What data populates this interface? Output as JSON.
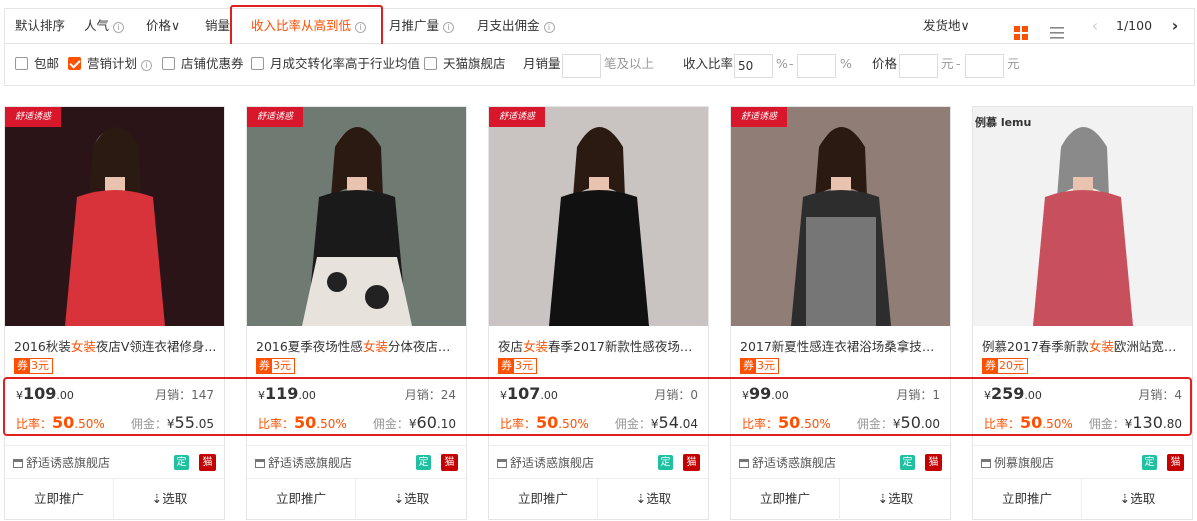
{
  "sortbar": {
    "items": [
      {
        "label": "默认排序"
      },
      {
        "label": "人气"
      },
      {
        "label": "价格"
      },
      {
        "label": "销量"
      },
      {
        "label": "收入比率从高到低"
      },
      {
        "label": "月推广量"
      },
      {
        "label": "月支出佣金"
      }
    ],
    "ship_from": "发货地",
    "page": "1/100",
    "info_glyph": "i",
    "arrow_glyph": "∨"
  },
  "filters": {
    "checkboxes": [
      {
        "label": "包邮",
        "checked": false
      },
      {
        "label": "营销计划",
        "checked": true
      },
      {
        "label": "店铺优惠券",
        "checked": false
      },
      {
        "label": "月成交转化率高于行业均值",
        "checked": false
      },
      {
        "label": "天猫旗舰店",
        "checked": false
      }
    ],
    "monthly_sales_label": "月销量",
    "monthly_sales_value": "",
    "monthly_sales_unit": "笔及以上",
    "income_rate_label": "收入比率",
    "income_rate_min": "50",
    "income_rate_max": "",
    "pct": "%",
    "dash": "-",
    "price_label": "价格",
    "price_min": "",
    "price_max": "",
    "yuan": "元"
  },
  "labels": {
    "coupon": "券",
    "yen": "¥",
    "sales": "月销：",
    "rate": "比率：",
    "commission": "佣金：",
    "promote": "立即推广",
    "select": "⇣选取",
    "ding": "定",
    "tmall": "猫"
  },
  "products": [
    {
      "title_pre": "2016秋装",
      "title_kw": "女装",
      "title_post": "夜店V领连衣裙修身...",
      "coupon": "3元",
      "price_int": "109",
      "price_dec": ".00",
      "sales": "147",
      "rate_int": "50",
      "rate_dec": ".50",
      "comm_int": "55",
      "comm_dec": ".05",
      "shop": "舒适诱惑旗舰店",
      "badge": "舒适诱惑",
      "img_bg": "#2a1418",
      "img_fg": "#d8323a"
    },
    {
      "title_pre": "2016夏季夜场性感",
      "title_kw": "女装",
      "title_post": "分体夜店连...",
      "coupon": "3元",
      "price_int": "119",
      "price_dec": ".00",
      "sales": "24",
      "rate_int": "50",
      "rate_dec": ".50",
      "comm_int": "60",
      "comm_dec": ".10",
      "shop": "舒适诱惑旗舰店",
      "badge": "舒适诱惑",
      "img_bg": "#6f7b72",
      "img_fg": "#1a1a1a"
    },
    {
      "title_pre": "夜店",
      "title_kw": "女装",
      "title_post": "春季2017新款性感夜场洗...",
      "coupon": "3元",
      "price_int": "107",
      "price_dec": ".00",
      "sales": "0",
      "rate_int": "50",
      "rate_dec": ".50",
      "comm_int": "54",
      "comm_dec": ".04",
      "shop": "舒适诱惑旗舰店",
      "badge": "舒适诱惑",
      "img_bg": "#c9c4c2",
      "img_fg": "#111111"
    },
    {
      "title_pre": "2017新夏性感连衣裙浴场桑拿技师...",
      "title_kw": "",
      "title_post": "",
      "coupon": "3元",
      "price_int": "99",
      "price_dec": ".00",
      "sales": "1",
      "rate_int": "50",
      "rate_dec": ".50",
      "comm_int": "50",
      "comm_dec": ".00",
      "shop": "舒适诱惑旗舰店",
      "badge": "舒适诱惑",
      "img_bg": "#8f7d76",
      "img_fg": "#2d2d2d"
    },
    {
      "title_pre": "例慕2017春季新款",
      "title_kw": "女装",
      "title_post": "欧洲站宽松...",
      "coupon": "20元",
      "price_int": "259",
      "price_dec": ".00",
      "sales": "4",
      "rate_int": "50",
      "rate_dec": ".50",
      "comm_int": "130",
      "comm_dec": ".80",
      "shop": "例慕旗舰店",
      "badge": "例慕 lemu",
      "img_bg": "#f2f2f2",
      "img_fg": "#c8505c"
    }
  ],
  "colors": {
    "accent": "#ff5000",
    "highlight_box": "#e02020"
  }
}
